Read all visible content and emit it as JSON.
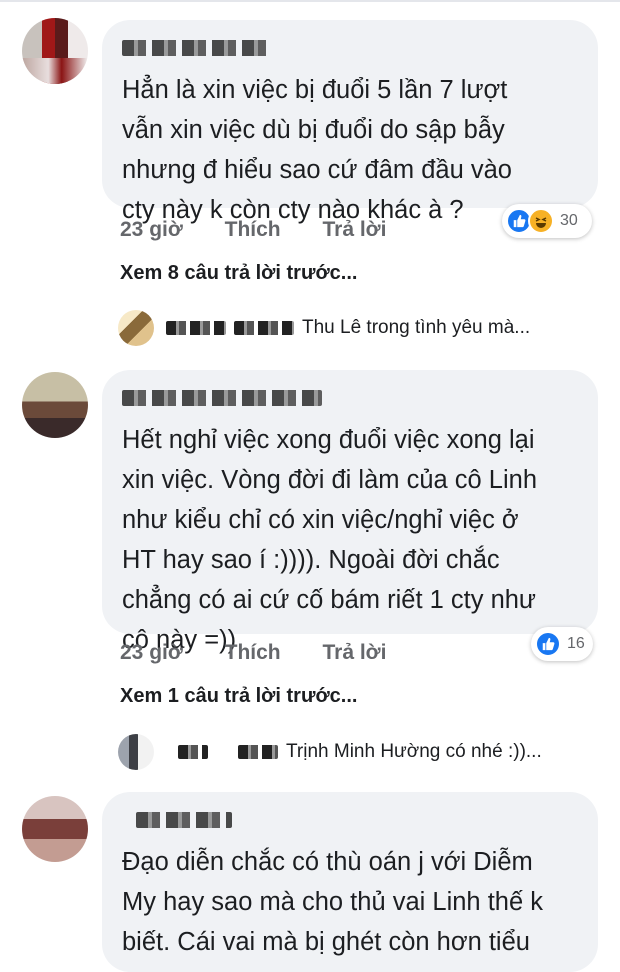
{
  "comments": [
    {
      "avatar": "blurred-avatar",
      "text": "Hẳn là xin việc bị đuổi 5 lần 7 lượt\nvẫn xin việc dù bị đuổi  do sập bẫy\nnhưng đ hiểu sao cứ đâm đầu vào\ncty này k còn cty nào khác à ?",
      "time": "23 giờ",
      "like": "Thích",
      "reply": "Trả lời",
      "reaction_count": "30",
      "reactions": [
        "like-icon",
        "haha-icon"
      ],
      "view_more": "Xem 8 câu trả lời trước...",
      "reply_preview": "Thu Lê trong tình yêu mà..."
    },
    {
      "avatar": "blurred-avatar",
      "text": "Hết nghỉ việc xong đuổi việc xong lại\nxin việc. Vòng đời đi làm của cô Linh\nnhư kiểu chỉ có xin việc/nghỉ việc ở\nHT hay sao í :)))). Ngoài đời chắc\nchẳng có ai cứ cố bám riết 1 cty như\ncô này =))",
      "time": "23 giờ",
      "like": "Thích",
      "reply": "Trả lời",
      "reaction_count": "16",
      "reactions": [
        "like-icon"
      ],
      "view_more": "Xem 1 câu trả lời trước...",
      "reply_preview": "Trịnh Minh Hường có nhé :))..."
    },
    {
      "avatar": "blurred-avatar",
      "text": "Đạo diễn chắc có thù oán j với Diễm\nMy hay sao mà cho thủ vai Linh thế k\nbiết. Cái vai mà bị ghét còn hơn tiểu"
    }
  ],
  "colors": {
    "bubble": "#f0f2f5",
    "meta": "#65676b",
    "like": "#1877f2",
    "haha": "#f7b125"
  }
}
